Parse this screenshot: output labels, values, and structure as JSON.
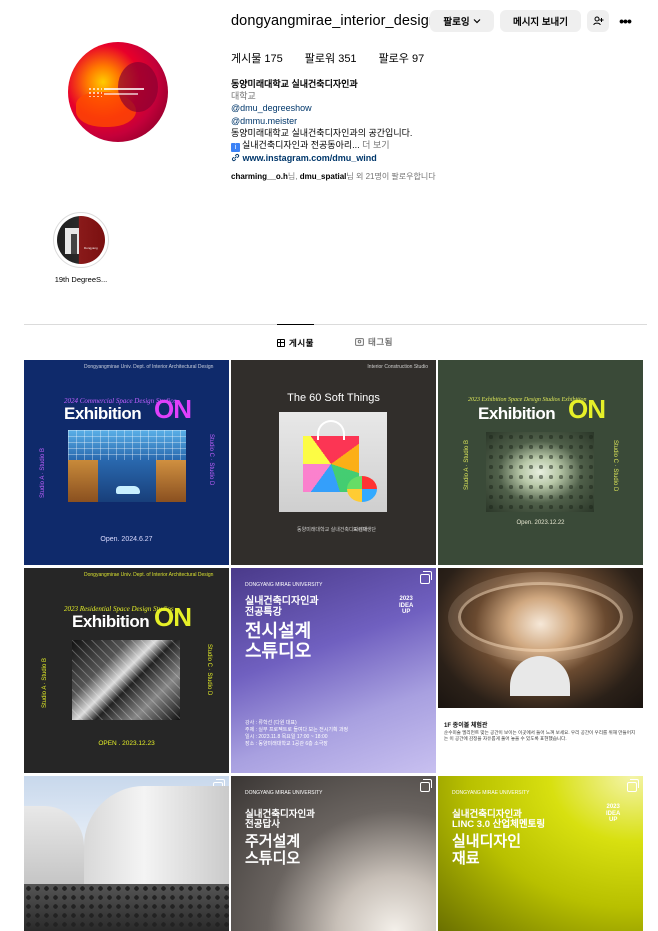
{
  "profile": {
    "username": "dongyangmirae_interior_design",
    "follow_label": "팔로잉",
    "message_label": "메시지 보내기",
    "more_label": "•••",
    "stats": {
      "posts": "게시물 175",
      "followers": "팔로워 351",
      "following": "팔로우 97"
    },
    "bio": {
      "name": "동양미래대학교 실내건축디자인과",
      "category": "대학교",
      "link1": "@dmu_degreeshow",
      "link2": "@dmmu.meister",
      "line1": "동양미래대학교 실내건축디자인과의 공간입니다.",
      "info_mark": "i",
      "line2": "실내건축디자인과 전공동아리...",
      "more": "더 보기",
      "website": "www.instagram.com/dmu_wind"
    },
    "followed_by": {
      "user1": "charming__o.h",
      "sep": "님, ",
      "user2": "dmu_spatial",
      "rest": "님 외 21명이 팔로우합니다"
    }
  },
  "highlight": {
    "label": "19th DegreeS...",
    "thumb_text": "Dongyang"
  },
  "tabs": {
    "posts": "게시물",
    "tagged": "태그됨"
  },
  "posts": {
    "p1": {
      "header": "Dongyangmirae Univ.  Dept. of Interior Architectural Design",
      "subtitle": "2024 Commercial Space Design Studios",
      "title": "Exhibition",
      "on": "ON",
      "left_vert": "Studio A  ·  Studio B",
      "right_vert": "Studio C  ·  Studio D",
      "date": "Open. 2024.6.27"
    },
    "p2": {
      "header": "Interior Construction Studio",
      "title": "The 60 Soft Things",
      "footer_left": "동양미래대학교 실내건축디자인과",
      "footer_right": "도시재생단"
    },
    "p3": {
      "subtitle": "2023 Exhibition Space Design Studios Exhibition",
      "title": "Exhibition",
      "on": "ON",
      "left_vert": "Studio A · Studio B",
      "right_vert": "Studio C · Studio D",
      "date": "Open. 2023.12.22"
    },
    "p4": {
      "header": "Dongyangmirae Univ.  Dept. of Interior Architectural Design",
      "subtitle": "2023 Residential Space Design Studios",
      "title": "Exhibition",
      "on": "ON",
      "left_vert": "Studio A  ·  Studio B",
      "right_vert": "Studio C  ·  Studio D",
      "date": "OPEN . 2023.12.23"
    },
    "p5": {
      "logo": "DONGYANG MIRAE UNIVERSITY",
      "small_title": "실내건축디자인과\n전공특강",
      "big_title": "전시설계\n스튜디오",
      "side_tag": "2023\nIDEA\nUP",
      "details": "강사 : 류학선 (다원 대표)\n주제 : 실무 프로젝트로 들여다 보는 전시기획 과정\n일시 : 2023.11.8 목요일 17:00 ~ 18:00\n장소 : 동양미래대학교 1공관 6층 소극장"
    },
    "p6": {
      "caption_title": "1F 종이볼 체험관",
      "caption_body": "순수미술 엘리먼트 맞는 공간이 보이는 이곳에서 들어 느껴 보세요. 우리 공간이 우리를 위해 만들어지는 이 공간에 감정을 자유롭게 풀어 놓을 수 있도록 표현했습니다."
    },
    "p8": {
      "logo": "DONGYANG MIRAE UNIVERSITY",
      "small_title": "실내건축디자인과\n전공답사",
      "big_title": "주거설계\n스튜디오"
    },
    "p9": {
      "logo": "DONGYANG MIRAE UNIVERSITY",
      "small_title": "실내건축디자인과\nLINC 3.0 산업체멘토링",
      "big_title": "실내디자인\n재료",
      "side_tag": "2023\nIDEA\nUP"
    }
  },
  "colors": {
    "button_bg": "#efefef",
    "link": "#00376b",
    "muted": "#737373",
    "p1_bg": "#0f2a6b",
    "p1_on": "#e040fb",
    "p3_bg": "#3a4a38",
    "p3_on": "#e6f028",
    "p4_bg": "#262626",
    "p4_on": "#e6f028"
  },
  "icons": {
    "follow_chevron": "chevron-down-icon",
    "add_person": "add-person-icon",
    "link": "link-icon",
    "posts_tab": "grid-icon",
    "tagged_tab": "tag-icon",
    "multi_image": "carousel-icon"
  }
}
